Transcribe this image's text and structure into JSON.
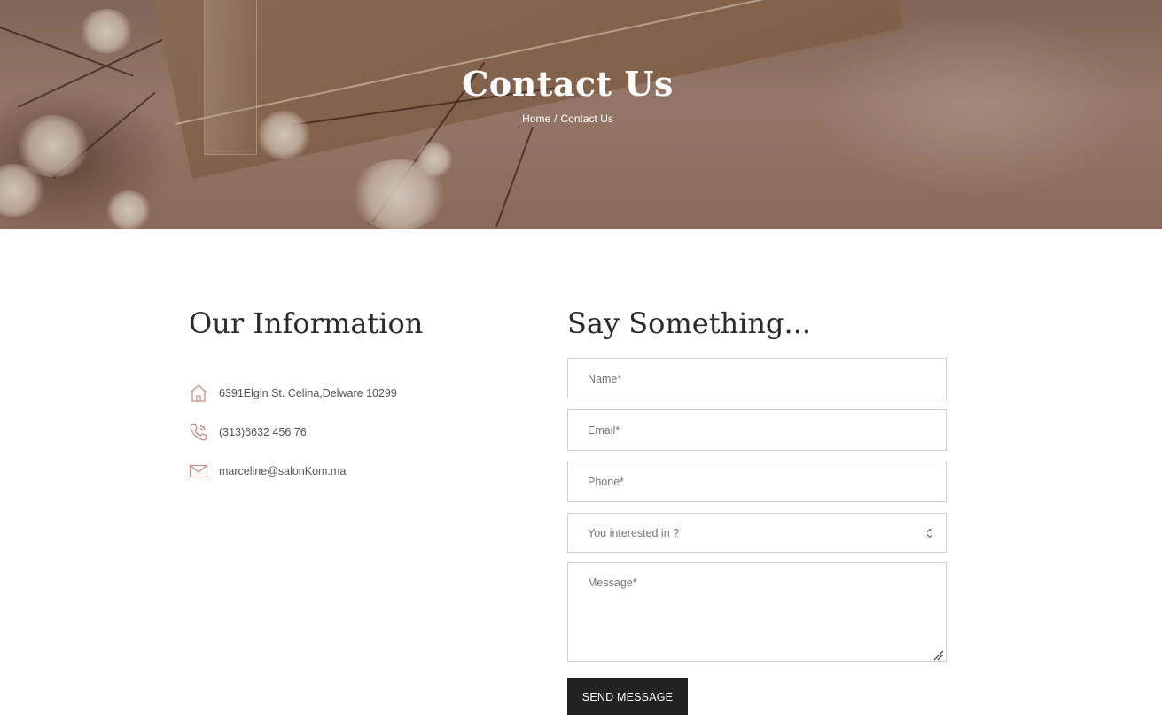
{
  "hero": {
    "title": "Contact Us",
    "breadcrumb": {
      "home": "Home",
      "separator": "/",
      "current": "Contact Us"
    }
  },
  "info": {
    "heading": "Our Information",
    "address": {
      "icon": "home-icon",
      "text": "6391Elgin St. Celina,Delware 10299"
    },
    "phone": {
      "icon": "phone-icon",
      "text": "(313)6632 456 76"
    },
    "email": {
      "icon": "mail-icon",
      "text": "marceline@salonKom.ma"
    },
    "icon_color": "#c98a7f"
  },
  "form": {
    "heading": "Say Something...",
    "name_placeholder": "Name*",
    "email_placeholder": "Email*",
    "phone_placeholder": "Phone*",
    "interest_placeholder": "You interested in ?",
    "message_placeholder": "Message*",
    "submit_label": "SEND MESSAGE",
    "button_color": "#222222"
  }
}
